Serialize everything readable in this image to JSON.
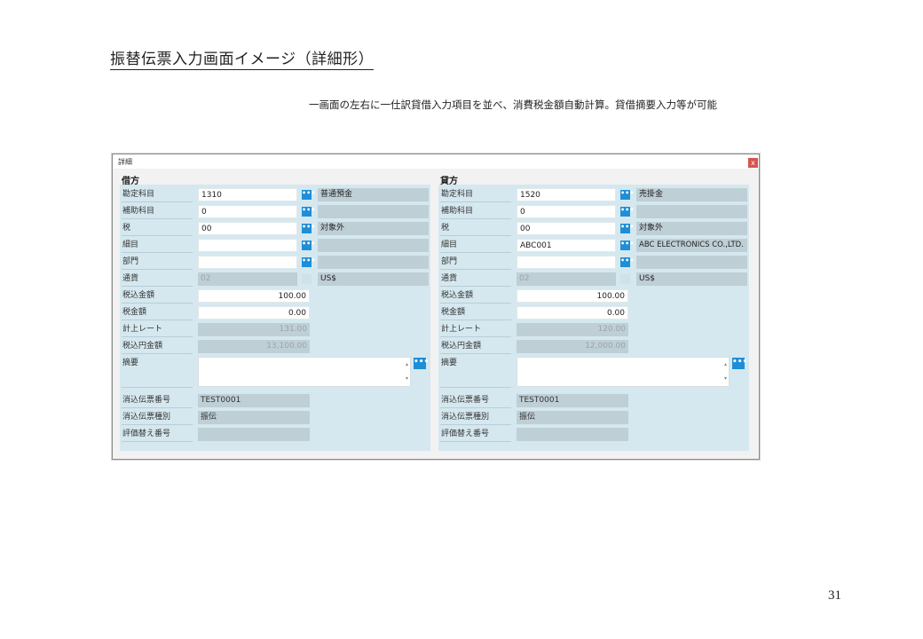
{
  "page": {
    "title": "振替伝票入力画面イメージ（詳細形）",
    "caption": "一画面の左右に一仕訳貸借入力項目を並べ、消費税金額自動計算。貸借摘要入力等が可能",
    "page_number": "31"
  },
  "dialog": {
    "title": "詳細",
    "close_label": "x",
    "button_label": "•••",
    "left": {
      "heading": "借方",
      "labels": {
        "account": "勘定科目",
        "sub_account": "補助科目",
        "tax": "税",
        "detail": "細目",
        "department": "部門",
        "currency": "通貨",
        "amount_incl_tax": "税込金額",
        "tax_amount": "税金額",
        "rate": "計上レート",
        "yen_amount": "税込円金額",
        "memo": "摘要",
        "reversal_no": "消込伝票番号",
        "reversal_type": "消込伝票種別",
        "revaluation_no": "評価替え番号"
      },
      "values": {
        "account_code": "1310",
        "account_name": "普通預金",
        "sub_account_code": "0",
        "sub_account_name": "",
        "tax_code": "00",
        "tax_name": "対象外",
        "detail_code": "",
        "detail_name": "",
        "department_code": "",
        "department_name": "",
        "currency_code": "02",
        "currency_name": "US$",
        "amount_incl_tax": "100.00",
        "tax_amount": "0.00",
        "rate": "131.00",
        "yen_amount": "13,100.00",
        "memo": "",
        "reversal_no": "TEST0001",
        "reversal_type": "振伝",
        "revaluation_no": ""
      }
    },
    "right": {
      "heading": "貸方",
      "labels": {
        "account": "勘定科目",
        "sub_account": "補助科目",
        "tax": "税",
        "detail": "細目",
        "department": "部門",
        "currency": "通貨",
        "amount_incl_tax": "税込金額",
        "tax_amount": "税金額",
        "rate": "計上レート",
        "yen_amount": "税込円金額",
        "memo": "摘要",
        "reversal_no": "消込伝票番号",
        "reversal_type": "消込伝票種別",
        "revaluation_no": "評価替え番号"
      },
      "values": {
        "account_code": "1520",
        "account_name": "売掛金",
        "sub_account_code": "0",
        "sub_account_name": "",
        "tax_code": "00",
        "tax_name": "対象外",
        "detail_code": "ABC001",
        "detail_name": "ABC ELECTRONICS CO.,LTD.",
        "department_code": "",
        "department_name": "",
        "currency_code": "02",
        "currency_name": "US$",
        "amount_incl_tax": "100.00",
        "tax_amount": "0.00",
        "rate": "120.00",
        "yen_amount": "12,000.00",
        "memo": "",
        "reversal_no": "TEST0001",
        "reversal_type": "振伝",
        "revaluation_no": ""
      }
    },
    "colors": {
      "panel_bg": "#d5e8ef",
      "readonly_bg": "#bfcfd6",
      "button_blue": "#1e8ed8",
      "close_red": "#d9534f"
    },
    "icons": {
      "lookup": "ellipsis-icon",
      "close": "close-icon",
      "memo_scroll": "scroll-arrows-icon"
    }
  }
}
